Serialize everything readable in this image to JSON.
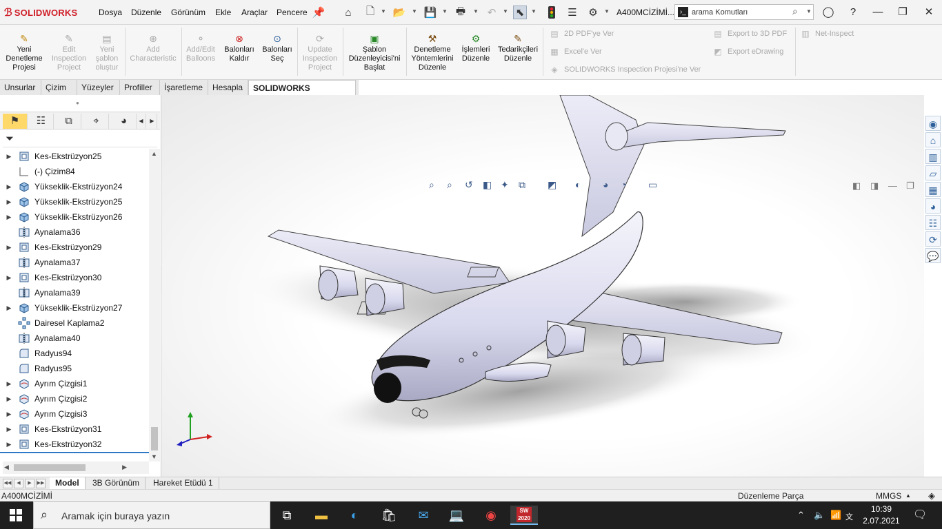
{
  "app": {
    "brand": "SOLIDWORKS",
    "document_title": "A400MCİZİMİ...."
  },
  "menu": [
    "Dosya",
    "Düzenle",
    "Görünüm",
    "Ekle",
    "Araçlar",
    "Pencere"
  ],
  "search": {
    "value": "arama Komutları"
  },
  "ribbon": {
    "buttons": [
      {
        "label": [
          "Yeni",
          "Denetleme",
          "Projesi"
        ],
        "enabled": true
      },
      {
        "label": [
          "Edit",
          "Inspection",
          "Project"
        ],
        "enabled": false
      },
      {
        "label": [
          "Yeni",
          "şablon",
          "oluştur"
        ],
        "enabled": false
      },
      {
        "label": [
          "Add",
          "Characteristic"
        ],
        "enabled": false
      },
      {
        "label": [
          "Add/Edit",
          "Balloons"
        ],
        "enabled": false
      },
      {
        "label": [
          "Balonları",
          "Kaldır"
        ],
        "enabled": true
      },
      {
        "label": [
          "Balonları",
          "Seç"
        ],
        "enabled": true
      },
      {
        "label": [
          "Update",
          "Inspection",
          "Project"
        ],
        "enabled": false
      },
      {
        "label": [
          "Şablon",
          "Düzenleyicisi'ni",
          "Başlat"
        ],
        "enabled": true
      },
      {
        "label": [
          "Denetleme",
          "Yöntemlerini",
          "Düzenle"
        ],
        "enabled": true
      },
      {
        "label": [
          "İşlemleri",
          "Düzenle"
        ],
        "enabled": true
      },
      {
        "label": [
          "Tedarikçileri",
          "Düzenle"
        ],
        "enabled": true
      }
    ],
    "export_items": {
      "pdf2d": "2D PDF'ye Ver",
      "excel": "Excel'e Ver",
      "sw_project": "SOLIDWORKS Inspection Projesi'ne Ver",
      "pdf3d": "Export to 3D PDF",
      "edrawing": "Export eDrawing",
      "net_inspect": "Net-Inspect"
    }
  },
  "command_tabs": [
    "Unsurlar",
    "Çizim",
    "Yüzeyler",
    "Profiller",
    "İşaretleme",
    "Hesapla",
    "SOLIDWORKS Inspection"
  ],
  "active_command_tab": "SOLIDWORKS Inspection",
  "feature_tree": [
    {
      "label": "Kes-Ekstrüzyon25",
      "icon": "cut-extrude",
      "expandable": true
    },
    {
      "label": "(-) Çizim84",
      "icon": "sketch",
      "expandable": false
    },
    {
      "label": "Yükseklik-Ekstrüzyon24",
      "icon": "boss-extrude",
      "expandable": true
    },
    {
      "label": "Yükseklik-Ekstrüzyon25",
      "icon": "boss-extrude",
      "expandable": true
    },
    {
      "label": "Yükseklik-Ekstrüzyon26",
      "icon": "boss-extrude",
      "expandable": true
    },
    {
      "label": "Aynalama36",
      "icon": "mirror",
      "expandable": false
    },
    {
      "label": "Kes-Ekstrüzyon29",
      "icon": "cut-extrude",
      "expandable": true
    },
    {
      "label": "Aynalama37",
      "icon": "mirror",
      "expandable": false
    },
    {
      "label": "Kes-Ekstrüzyon30",
      "icon": "cut-extrude",
      "expandable": true
    },
    {
      "label": "Aynalama39",
      "icon": "mirror",
      "expandable": false
    },
    {
      "label": "Yükseklik-Ekstrüzyon27",
      "icon": "boss-extrude",
      "expandable": true
    },
    {
      "label": "Dairesel Kaplama2",
      "icon": "circular-pattern",
      "expandable": false
    },
    {
      "label": "Aynalama40",
      "icon": "mirror",
      "expandable": false
    },
    {
      "label": "Radyus94",
      "icon": "fillet",
      "expandable": false
    },
    {
      "label": "Radyus95",
      "icon": "fillet",
      "expandable": false
    },
    {
      "label": "Ayrım Çizgisi1",
      "icon": "split-line",
      "expandable": true
    },
    {
      "label": "Ayrım Çizgisi2",
      "icon": "split-line",
      "expandable": true
    },
    {
      "label": "Ayrım Çizgisi3",
      "icon": "split-line",
      "expandable": true
    },
    {
      "label": "Kes-Ekstrüzyon31",
      "icon": "cut-extrude",
      "expandable": true
    },
    {
      "label": "Kes-Ekstrüzyon32",
      "icon": "cut-extrude",
      "expandable": true
    }
  ],
  "bottom_tabs": [
    "Model",
    "3B Görünüm",
    "Hareket Etüdü 1"
  ],
  "active_bottom_tab": "Model",
  "status": {
    "document": "A400MCİZİMİ",
    "mode": "Düzenleme Parça",
    "units": "MMGS"
  },
  "taskbar": {
    "search_placeholder": "Aramak için buraya yazın",
    "time": "10:39",
    "date": "2.07.2021",
    "app_label": "2020"
  },
  "colors": {
    "brand_red": "#d0202a",
    "active_tab_yellow": "#ffd86a",
    "tree_selection_blue": "#2e78c8"
  }
}
